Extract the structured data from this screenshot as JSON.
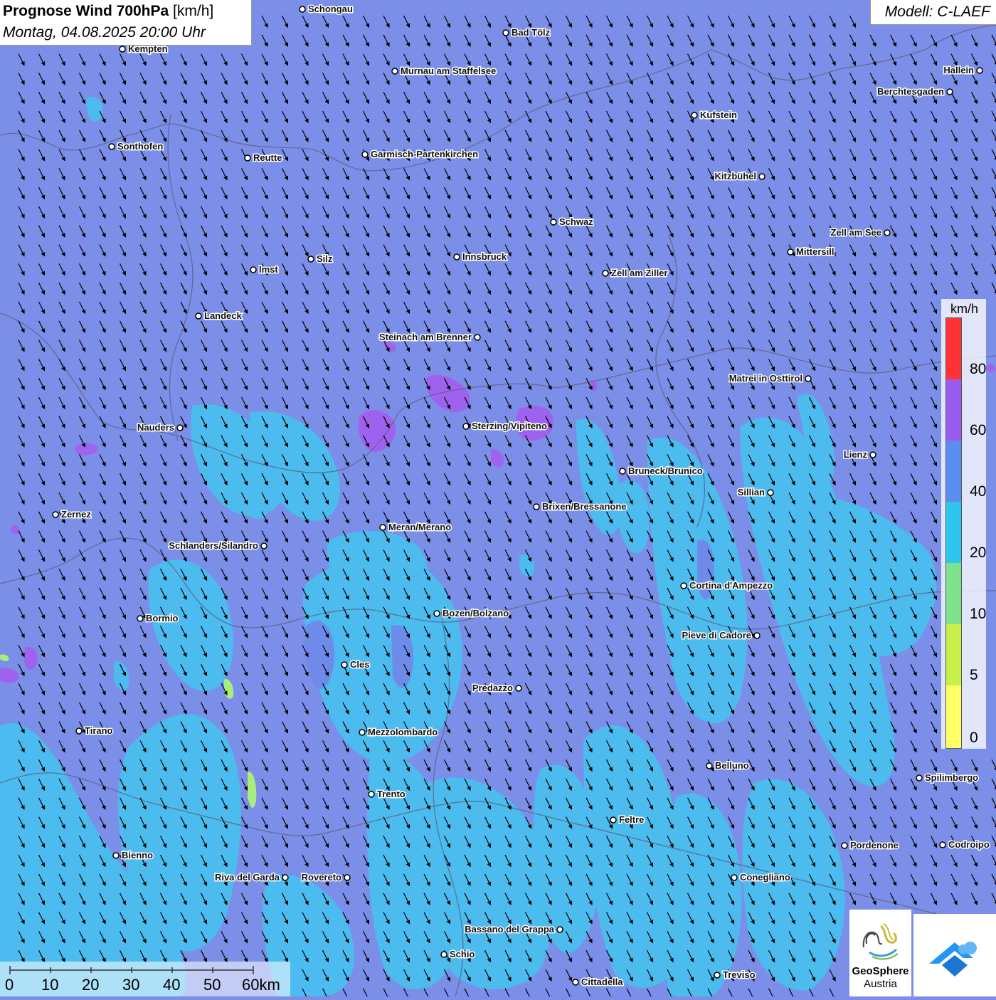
{
  "header": {
    "title": "Prognose Wind 700hPa",
    "unit": "[km/h]",
    "datetime": "Montag, 04.08.2025 20:00 Uhr"
  },
  "model_label": "Modell: C-LAEF",
  "legend": {
    "unit": "km/h",
    "ticks": [
      "80",
      "60",
      "40",
      "20",
      "10",
      "5",
      "0"
    ],
    "colors": [
      "#ff3333",
      "#9a5bf0",
      "#5b8ef0",
      "#2ec6ee",
      "#7ee38a",
      "#c8f04a",
      "#ffff66"
    ]
  },
  "scale_bar": {
    "labels": [
      "0",
      "10",
      "20",
      "30",
      "40",
      "50",
      "60km"
    ]
  },
  "logos": {
    "geosphere_line1": "GeoSphere",
    "geosphere_line2": "Austria"
  },
  "map": {
    "background_color": "#7b8fe8",
    "wind_direction": "from north-west (arrows pointing south-east)",
    "cities": [
      {
        "name": "Schongau"
      },
      {
        "name": "Bad Tölz"
      },
      {
        "name": "Kempten"
      },
      {
        "name": "Murnau am Staffelsee"
      },
      {
        "name": "Hallein"
      },
      {
        "name": "Berchtesgaden"
      },
      {
        "name": "Kufstein"
      },
      {
        "name": "Sonthofen"
      },
      {
        "name": "Reutte"
      },
      {
        "name": "Garmisch-Partenkirchen"
      },
      {
        "name": "Kitzbühel"
      },
      {
        "name": "Schwaz"
      },
      {
        "name": "Zell am See"
      },
      {
        "name": "Mittersill"
      },
      {
        "name": "Innsbruck"
      },
      {
        "name": "Silz"
      },
      {
        "name": "Imst"
      },
      {
        "name": "Zell am Ziller"
      },
      {
        "name": "Landeck"
      },
      {
        "name": "Steinach am Brenner"
      },
      {
        "name": "Matrei in Osttirol"
      },
      {
        "name": "Nauders"
      },
      {
        "name": "Sterzing/Vipiteno"
      },
      {
        "name": "Lienz"
      },
      {
        "name": "Bruneck/Brunico"
      },
      {
        "name": "Sillian"
      },
      {
        "name": "Zernez"
      },
      {
        "name": "Brixen/Bressanone"
      },
      {
        "name": "Meran/Merano"
      },
      {
        "name": "Schlanders/Silandro"
      },
      {
        "name": "Cortina d'Ampezzo"
      },
      {
        "name": "Bozen/Bolzano"
      },
      {
        "name": "Bormio"
      },
      {
        "name": "Pieve di Cadore"
      },
      {
        "name": "Cles"
      },
      {
        "name": "Predazzo"
      },
      {
        "name": "Tirano"
      },
      {
        "name": "Mezzolombardo"
      },
      {
        "name": "Belluno"
      },
      {
        "name": "Spilimbergo"
      },
      {
        "name": "Trento"
      },
      {
        "name": "Feltre"
      },
      {
        "name": "Bienno"
      },
      {
        "name": "Pordenone"
      },
      {
        "name": "Codroipo"
      },
      {
        "name": "Riva del Garda"
      },
      {
        "name": "Rovereto"
      },
      {
        "name": "Conegliano"
      },
      {
        "name": "Bassano del Grappa"
      },
      {
        "name": "Schio"
      },
      {
        "name": "Treviso"
      },
      {
        "name": "Cittadella"
      }
    ]
  }
}
